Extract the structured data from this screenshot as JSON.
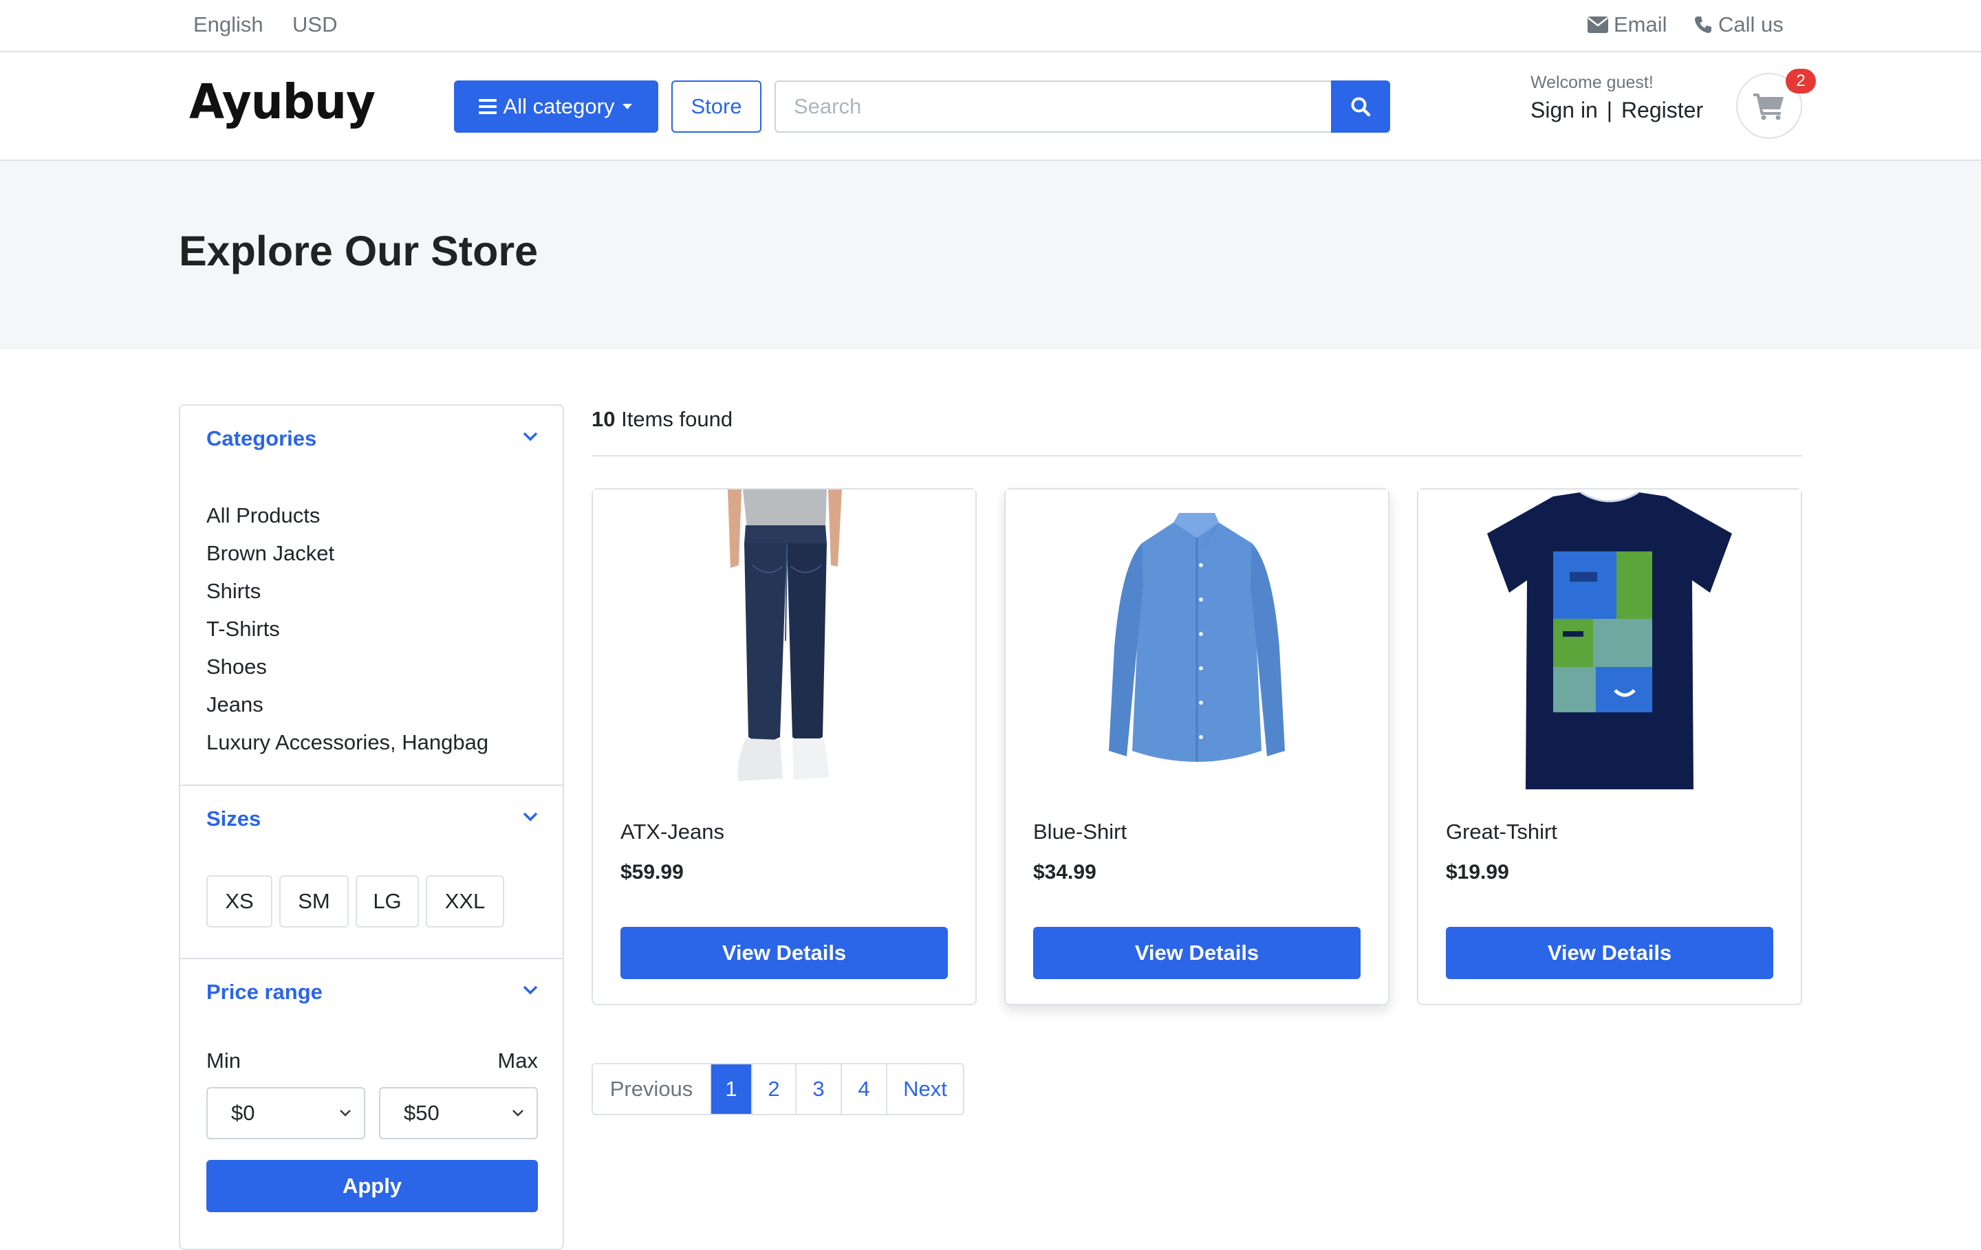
{
  "topbar": {
    "language": "English",
    "currency": "USD",
    "email_label": "Email",
    "call_label": "Call us"
  },
  "header": {
    "logo": "Ayubuy",
    "all_category_label": "All category",
    "store_label": "Store",
    "search_placeholder": "Search",
    "search_value": "",
    "welcome": "Welcome guest!",
    "sign_in": "Sign in",
    "separator": "|",
    "register": "Register",
    "cart_count": "2"
  },
  "hero": {
    "title": "Explore Our Store"
  },
  "sidebar": {
    "categories_title": "Categories",
    "categories": [
      "All Products",
      "Brown Jacket",
      "Shirts",
      "T-Shirts",
      "Shoes",
      "Jeans",
      "Luxury Accessories, Hangbag"
    ],
    "sizes_title": "Sizes",
    "sizes": [
      "XS",
      "SM",
      "LG",
      "XXL"
    ],
    "price_title": "Price range",
    "min_label": "Min",
    "max_label": "Max",
    "min_value": "$0",
    "max_value": "$50",
    "apply_label": "Apply"
  },
  "results": {
    "count": "10",
    "count_suffix": "Items found"
  },
  "products": [
    {
      "name": "ATX-Jeans",
      "price": "$59.99",
      "button": "View Details"
    },
    {
      "name": "Blue-Shirt",
      "price": "$34.99",
      "button": "View Details"
    },
    {
      "name": "Great-Tshirt",
      "price": "$19.99",
      "button": "View Details"
    }
  ],
  "pagination": {
    "previous": "Previous",
    "pages": [
      "1",
      "2",
      "3",
      "4"
    ],
    "active_page": "1",
    "next": "Next"
  },
  "colors": {
    "primary": "#2b65e8",
    "badge": "#e53935",
    "hero_bg": "#f5f6f8"
  }
}
